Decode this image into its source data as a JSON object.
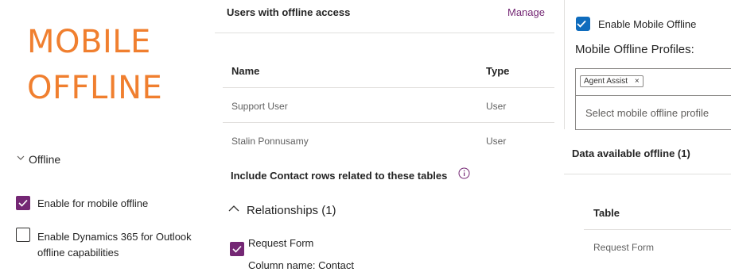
{
  "title_lines": [
    "MOBILE",
    "OFFLINE"
  ],
  "left_panel": {
    "section_label": "Offline",
    "enable_mobile_label": "Enable for mobile offline",
    "enable_outlook_line1": "Enable Dynamics 365 for Outlook",
    "enable_outlook_line2": "offline capabilities"
  },
  "middle_panel": {
    "users_heading": "Users with offline access",
    "manage_link": "Manage",
    "columns": {
      "name": "Name",
      "type": "Type"
    },
    "rows": [
      {
        "name": "Support User",
        "type": "User"
      },
      {
        "name": "Stalin Ponnusamy",
        "type": "User"
      }
    ],
    "include_label": "Include Contact rows related to these tables",
    "relationships_label": "Relationships (1)",
    "relationship_item": "Request Form",
    "relationship_column": "Column name: Contact"
  },
  "right_panel": {
    "enable_offline_label": "Enable Mobile Offline",
    "profiles_label": "Mobile Offline Profiles:",
    "profile_tag": "Agent Assist",
    "tag_remove": "×",
    "select_placeholder": "Select mobile offline profile",
    "data_available_label": "Data available offline (1)",
    "table_header": "Table",
    "table_rows": [
      "Request Form"
    ]
  },
  "colors": {
    "title": "#f07f2f",
    "checkbox_purple": "#742774",
    "checkbox_blue": "#0f6cbd",
    "manage_link": "#742774"
  }
}
